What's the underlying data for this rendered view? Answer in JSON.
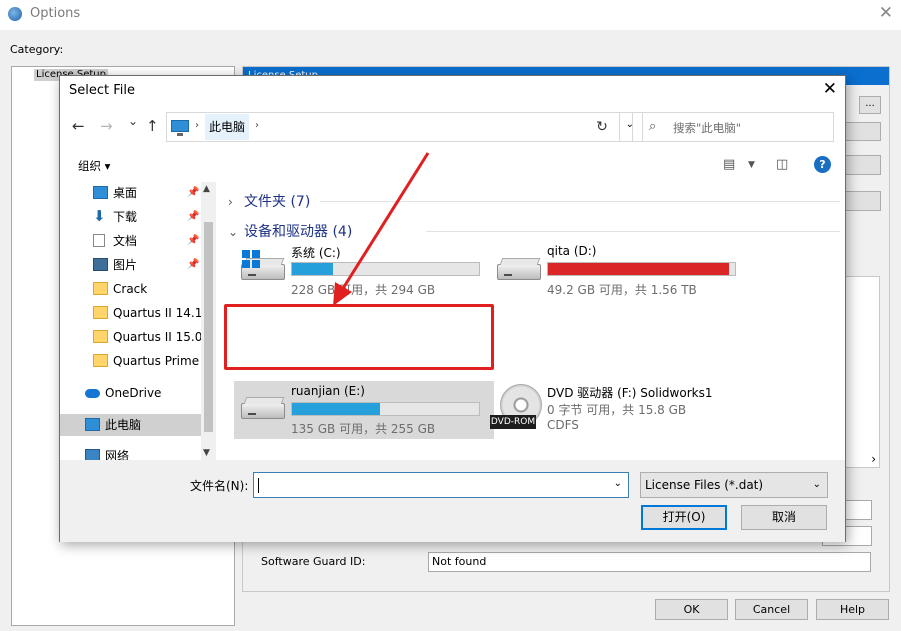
{
  "options_window": {
    "title": "Options",
    "close": "✕",
    "category_label": "Category:",
    "category_item": "License Setup",
    "panel_header": "License Setup",
    "browse_button": "...",
    "software_guard_label": "Software Guard ID:",
    "software_guard_value": "Not found",
    "buttons": {
      "ok": "OK",
      "cancel": "Cancel",
      "help": "Help"
    }
  },
  "dialog": {
    "title": "Select File",
    "close": "✕",
    "nav": {
      "back": "←",
      "forward": "→",
      "recent": "⌄",
      "up": "↑"
    },
    "address": {
      "separator": "›",
      "crumb": "此电脑",
      "dropdown": "⌄"
    },
    "refresh": "↻",
    "search_placeholder": "搜索\"此电脑\"",
    "organize": "组织 ▾",
    "help": "?",
    "nav_items": [
      {
        "label": "桌面",
        "icon": "desktop-icon",
        "pinned": true
      },
      {
        "label": "下载",
        "icon": "download-icon",
        "pinned": true
      },
      {
        "label": "文档",
        "icon": "documents-icon",
        "pinned": true
      },
      {
        "label": "图片",
        "icon": "pictures-icon",
        "pinned": true
      },
      {
        "label": "Crack",
        "icon": "folder-icon",
        "pinned": false
      },
      {
        "label": "Quartus II 14.1",
        "icon": "folder-icon",
        "pinned": false
      },
      {
        "label": "Quartus II 15.0",
        "icon": "folder-icon",
        "pinned": false
      },
      {
        "label": "Quartus Prime",
        "icon": "folder-icon",
        "pinned": false
      },
      {
        "label": "OneDrive",
        "icon": "onedrive-icon",
        "pinned": false
      },
      {
        "label": "此电脑",
        "icon": "this-pc-icon",
        "pinned": false,
        "selected": true
      },
      {
        "label": "网络",
        "icon": "network-icon",
        "pinned": false
      }
    ],
    "groups": {
      "folders": "文件夹 (7)",
      "devices": "设备和驱动器 (4)"
    },
    "drives": [
      {
        "name": "系统 (C:)",
        "info": "228 GB 可用，共 294 GB",
        "used_fraction": 0.22,
        "bar_color": "#26a0da"
      },
      {
        "name": "qita (D:)",
        "info": "49.2 GB 可用，共 1.56 TB",
        "used_fraction": 0.97,
        "bar_color": "#da2626"
      },
      {
        "name": "ruanjian (E:)",
        "info": "135 GB 可用，共 255 GB",
        "used_fraction": 0.47,
        "bar_color": "#26a0da",
        "selected": true
      },
      {
        "name": "DVD 驱动器 (F:) Solidworks1",
        "info": "0 字节 可用，共 15.8 GB",
        "info2": "CDFS",
        "badge": "DVD-ROM"
      }
    ],
    "filename_label": "文件名(N):",
    "filename_value": "",
    "file_type": "License Files (*.dat)",
    "open_button": "打开(O)",
    "cancel_button": "取消"
  },
  "colors": {
    "accent": "#0078d7",
    "annotation": "#e02020",
    "panel_header": "#0a6fcf"
  }
}
